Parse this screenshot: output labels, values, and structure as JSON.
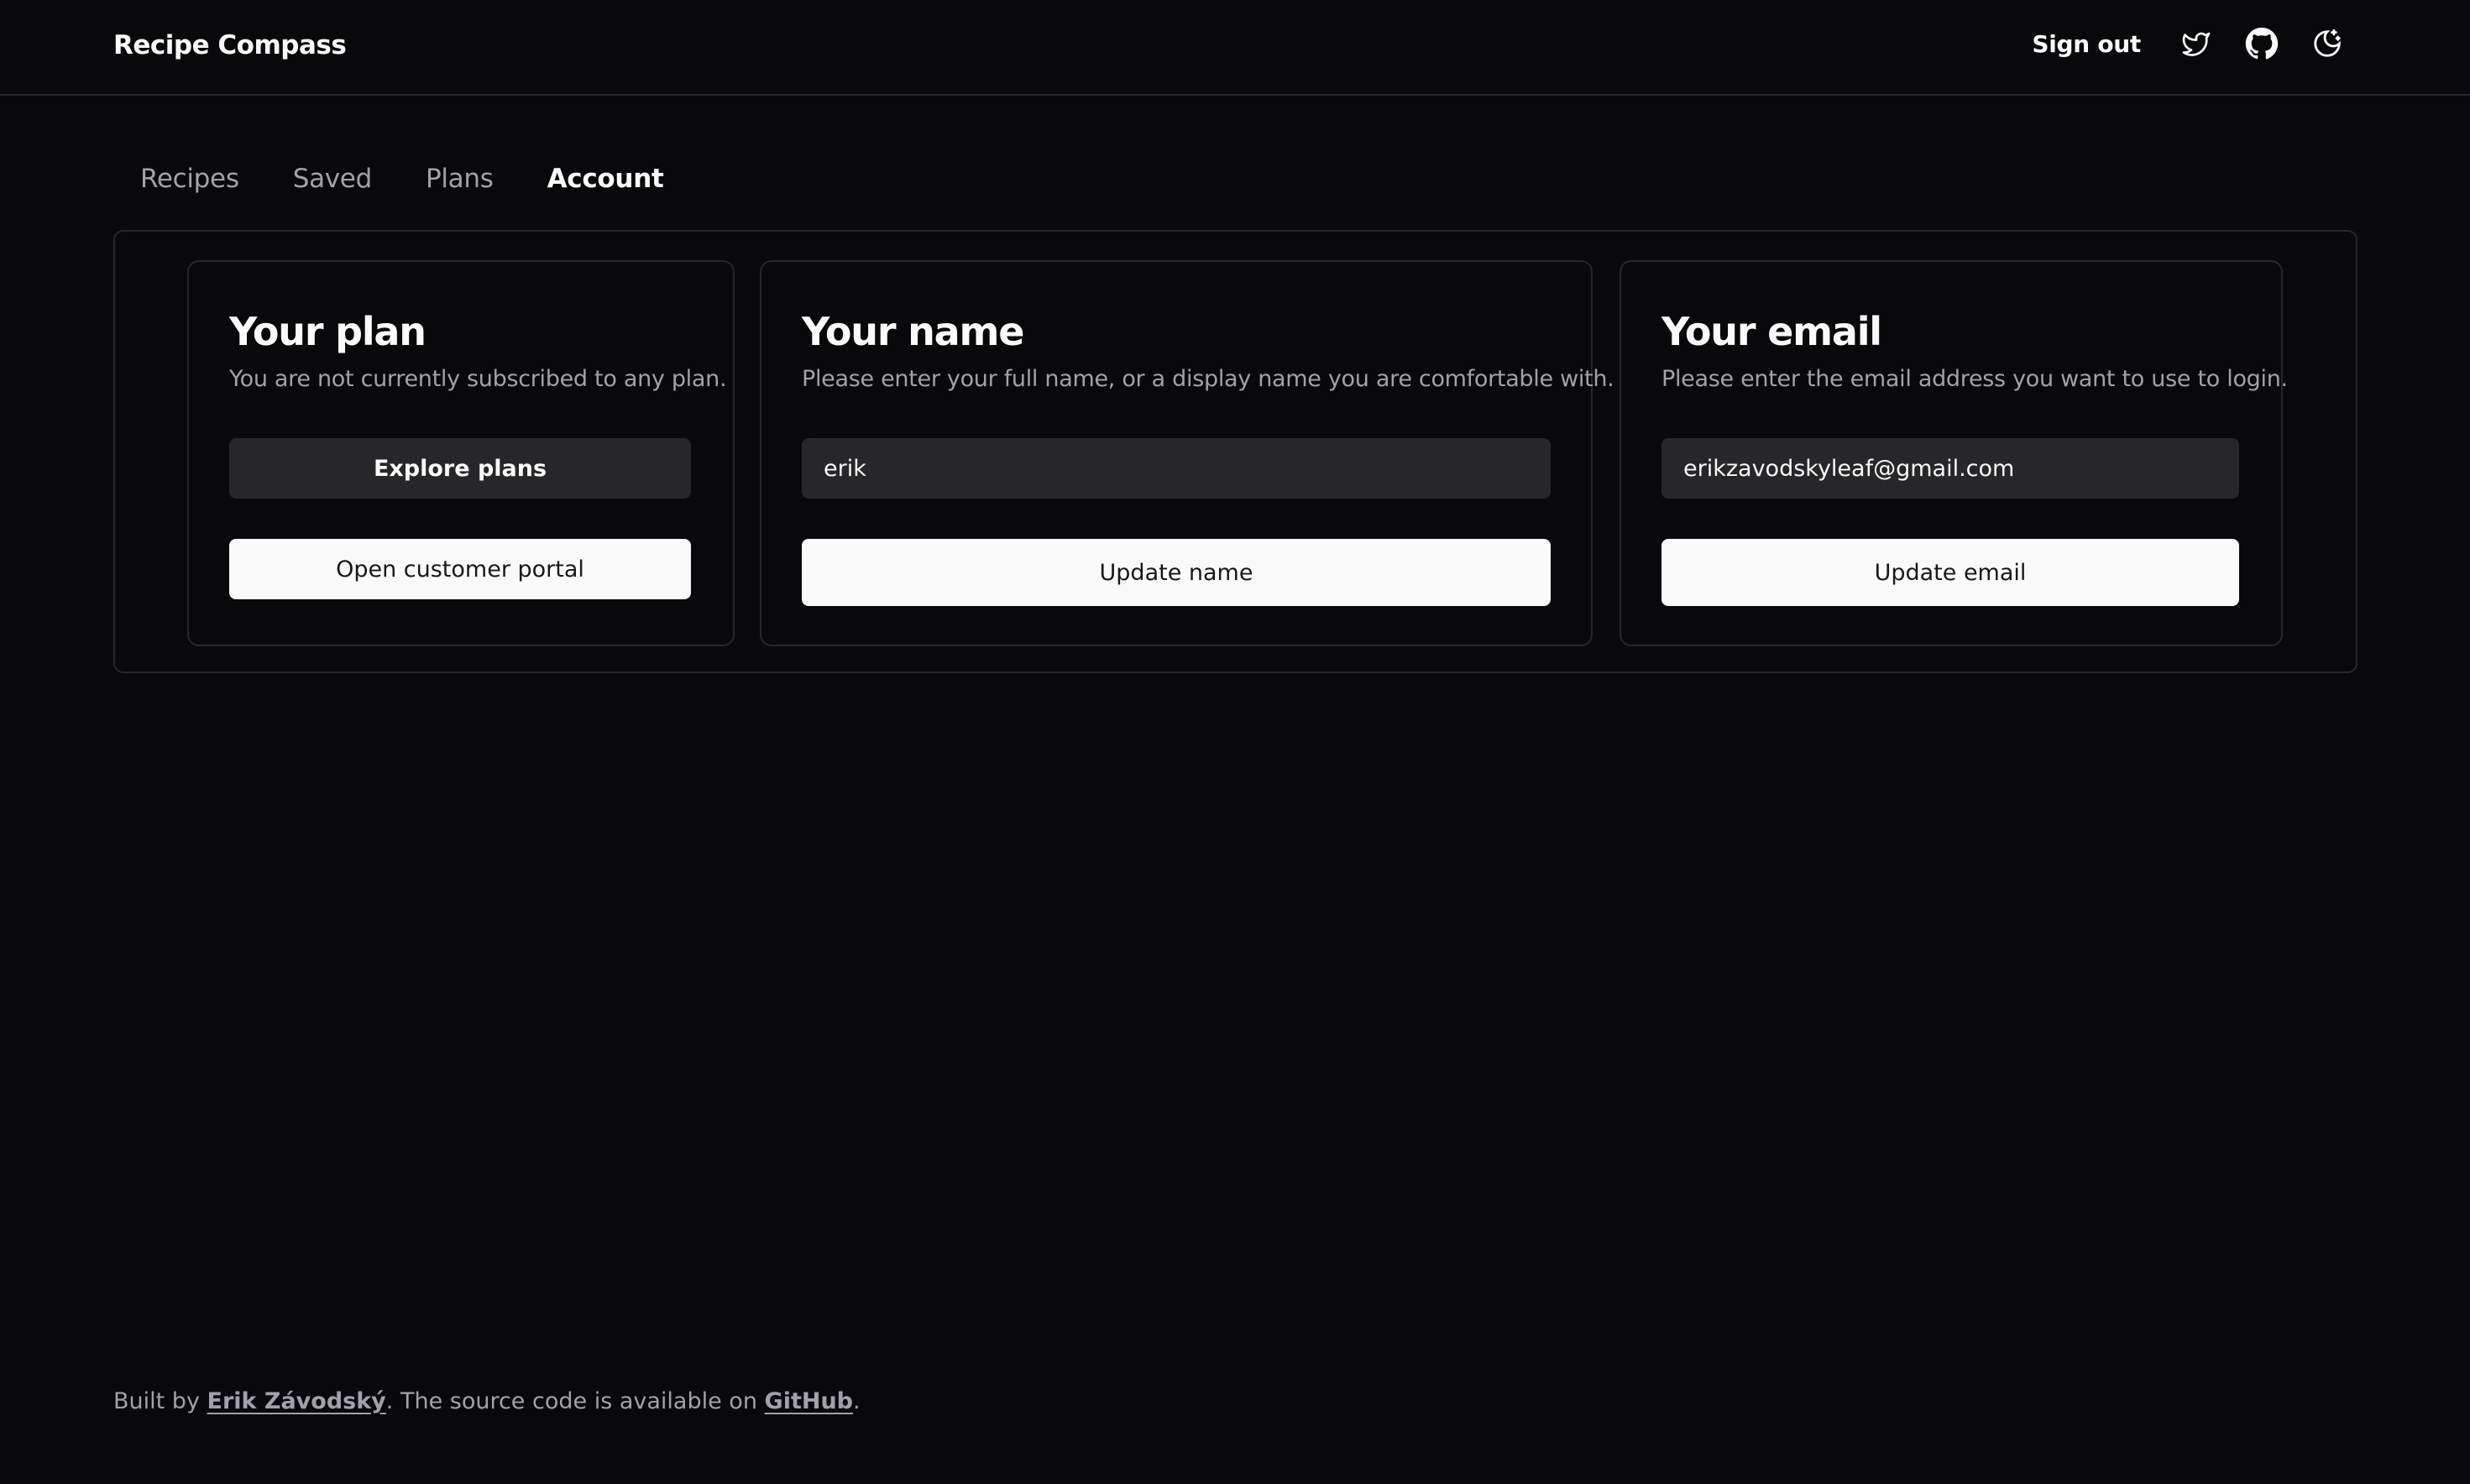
{
  "header": {
    "brand": "Recipe Compass",
    "sign_out": "Sign out",
    "icons": [
      "twitter-icon",
      "github-icon",
      "theme-toggle-icon"
    ]
  },
  "tabs": [
    {
      "label": "Recipes",
      "active": false
    },
    {
      "label": "Saved",
      "active": false
    },
    {
      "label": "Plans",
      "active": false
    },
    {
      "label": "Account",
      "active": true
    }
  ],
  "plan_card": {
    "title": "Your plan",
    "description": "You are not currently subscribed to any plan.",
    "explore_button": "Explore plans",
    "portal_button": "Open customer portal"
  },
  "name_card": {
    "title": "Your name",
    "description": "Please enter your full name, or a display name you are comfortable with.",
    "value": "erik",
    "button": "Update name"
  },
  "email_card": {
    "title": "Your email",
    "description": "Please enter the email address you want to use to login.",
    "value": "erikzavodskyleaf@gmail.com",
    "button": "Update email"
  },
  "footer": {
    "prefix": "Built by ",
    "author": "Erik Závodský",
    "middle": ". The source code is available on ",
    "github": "GitHub",
    "suffix": "."
  },
  "colors": {
    "background": "#09090b",
    "border": "#27272a",
    "muted_text": "#a1a1aa",
    "input_bg": "#27272a",
    "primary_button": "#fafafa"
  }
}
